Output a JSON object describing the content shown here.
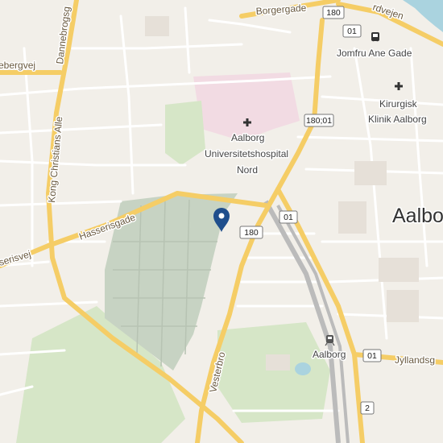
{
  "map": {
    "colors": {
      "land": "#f2efe9",
      "green": "#d6e6c7",
      "cemetery": "#c7d3c3",
      "hospital": "#f2dbe3",
      "water": "#aad3df",
      "major_road": "#f5cd66",
      "minor_road": "#ffffff",
      "railway": "#bbbbbb",
      "marker": "#1f4e8c"
    },
    "street_labels": [
      {
        "id": "borgergade",
        "text": "Borgergade"
      },
      {
        "id": "vejen",
        "text": "rdvejen"
      },
      {
        "id": "dannebrogsgade",
        "text": "Dannebrogsg"
      },
      {
        "id": "bergvej",
        "text": "ebergvej"
      },
      {
        "id": "kong-christians-alle",
        "text": "Kong Christians Alle"
      },
      {
        "id": "hasserisgade",
        "text": "Hasserisgade"
      },
      {
        "id": "hasserisvej",
        "text": "serisvej"
      },
      {
        "id": "vesterbro",
        "text": "Vesterbro"
      },
      {
        "id": "jyllandsgade",
        "text": "Jyllandsg"
      }
    ],
    "poi_labels": [
      {
        "id": "jomfru-ane-gade",
        "text": "Jomfru Ane Gade"
      },
      {
        "id": "kirurgisk-1",
        "text": "Kirurgisk"
      },
      {
        "id": "kirurgisk-2",
        "text": "Klinik Aalborg"
      },
      {
        "id": "hospital-1",
        "text": "Aalborg"
      },
      {
        "id": "hospital-2",
        "text": "Universitetshospital"
      },
      {
        "id": "hospital-3",
        "text": "Nord"
      },
      {
        "id": "station",
        "text": "Aalborg"
      }
    ],
    "city_label": "Aalborg",
    "shields": [
      {
        "id": "s180-top",
        "text": "180"
      },
      {
        "id": "s01-top",
        "text": "01"
      },
      {
        "id": "s180-01",
        "text": "180;01"
      },
      {
        "id": "s01-mid",
        "text": "01"
      },
      {
        "id": "s180-mid",
        "text": "180"
      },
      {
        "id": "s01-bottom",
        "text": "01"
      },
      {
        "id": "s2",
        "text": "2"
      }
    ],
    "icons": [
      "bus-icon",
      "hospital-cross-icon",
      "hospital-cross-icon",
      "train-icon",
      "location-pin-icon"
    ]
  }
}
